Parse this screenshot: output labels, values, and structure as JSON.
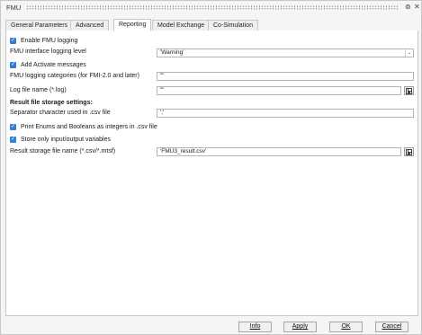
{
  "window": {
    "title": "FMU",
    "help_glyph": "⊚",
    "close_glyph": "✕"
  },
  "tabs": [
    {
      "label": "General Parameters"
    },
    {
      "label": "Advanced"
    },
    {
      "label": "Reporting"
    },
    {
      "label": "Model Exchange"
    },
    {
      "label": "Co-Simulation"
    }
  ],
  "active_tab": "Reporting",
  "reporting": {
    "enable_logging": {
      "label": "Enable FMU logging",
      "checked": true
    },
    "logging_level": {
      "label": "FMU interface logging level",
      "value": "'Warning'"
    },
    "activate_messages": {
      "label": "Add Activate messages",
      "checked": true
    },
    "logging_categories": {
      "label": "FMU logging categories (for FMI-2.0 and later)",
      "value": "\"\""
    },
    "log_file": {
      "label": "Log file name (*.log)",
      "value": "\"\""
    },
    "result_section": {
      "label": "Result file storage settings:"
    },
    "separator": {
      "label": "Separator character used in .csv file",
      "value": "';'"
    },
    "print_enums": {
      "label": "Print Enums and Booleans as integers in .csv file",
      "checked": true
    },
    "store_io": {
      "label": "Store only input/output variables",
      "checked": true
    },
    "result_file": {
      "label": "Result storage file name (*.csv/*.mtsf)",
      "value": "'FMU3_result.csv'"
    }
  },
  "buttons": {
    "info": "Info",
    "apply": "Apply",
    "ok": "OK",
    "cancel": "Cancel"
  }
}
